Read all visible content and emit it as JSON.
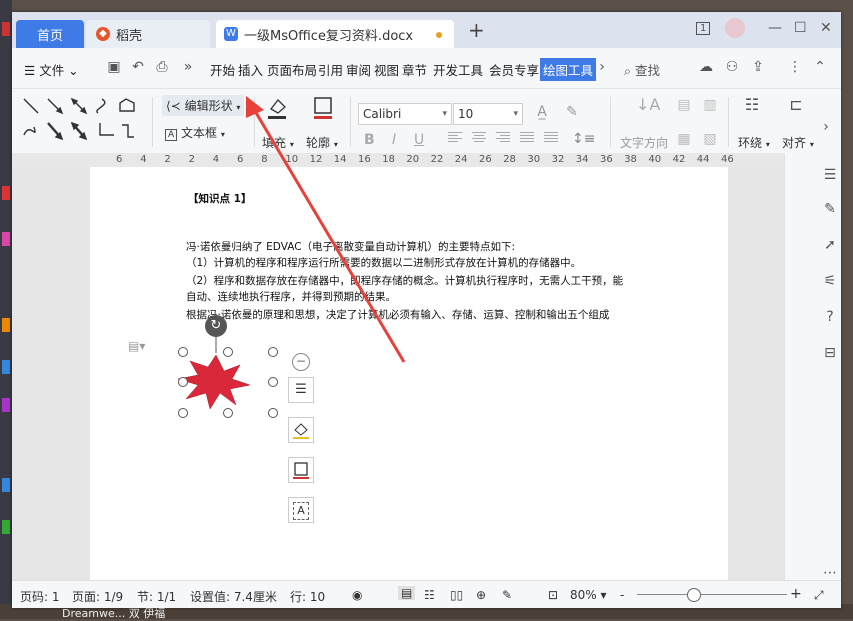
{
  "tabs": {
    "home": "首页",
    "daoke": "稻壳",
    "doc": "一级MsOffice复习资料.docx",
    "new": "+"
  },
  "window_controls": {
    "tabs_count": "1",
    "minimize": "—",
    "restore": "☐",
    "close": "✕"
  },
  "menu": {
    "file": "文件",
    "items": [
      "开始",
      "插入",
      "页面布局",
      "引用",
      "审阅",
      "视图",
      "章节",
      "开发工具",
      "会员专享"
    ],
    "active": "绘图工具",
    "search": "查找"
  },
  "ribbon": {
    "edit_shape": "编辑形状",
    "text_box": "文本框",
    "fill": "填充",
    "outline": "轮廓",
    "font_name": "Calibri",
    "font_size": "10",
    "text_direction": "文字方向",
    "wrap": "环绕",
    "align": "对齐",
    "bold": "B",
    "italic": "I",
    "underline": "U"
  },
  "ruler_numbers": [
    "6",
    "4",
    "2",
    "2",
    "4",
    "6",
    "8",
    "10",
    "12",
    "14",
    "16",
    "18",
    "20",
    "22",
    "24",
    "26",
    "28",
    "30",
    "32",
    "34",
    "36",
    "38",
    "40",
    "42",
    "44",
    "46"
  ],
  "document": {
    "heading": "【知识点 1】",
    "lines": [
      "冯·诺依曼归纳了 EDVAC（电子离散变量自动计算机）的主要特点如下:",
      "（1）计算机的程序和程序运行所需要的数据以二进制形式存放在计算机的存储器中。",
      "（2）程序和数据存放在存储器中，即程序存储的概念。计算机执行程序时，无需人工干预，能",
      "自动、连续地执行程序，并得到预期的结果。",
      "根据冯·诺依曼的原理和思想，决定了计算机必须有输入、存储、运算、控制和输出五个组成"
    ]
  },
  "statusbar": {
    "page_code": "页码: 1",
    "page": "页面: 1/9",
    "section": "节: 1/1",
    "setting": "设置值: 7.4厘米",
    "row": "行: 10",
    "zoom": "80%",
    "zoom_minus": "-",
    "zoom_plus": "+"
  },
  "desktop": {
    "bottom_text": "Dreamwe... 双 伊福"
  },
  "colors": {
    "accent": "#3e7be6",
    "star": "#d9283a",
    "arrow": "#e8403a"
  }
}
